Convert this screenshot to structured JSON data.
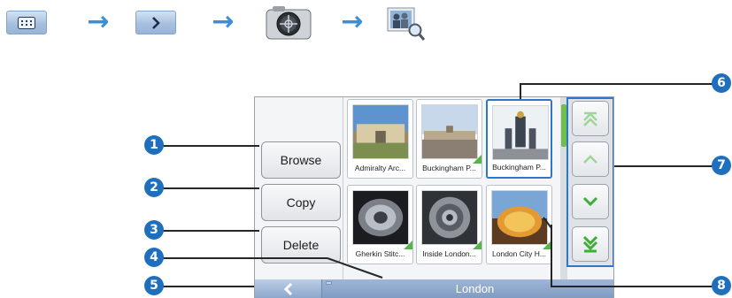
{
  "navigation_sequence": {
    "steps": [
      {
        "icon": "main-menu-grid-icon"
      },
      {
        "icon": "next-chevron-icon"
      },
      {
        "icon": "camera-icon"
      },
      {
        "icon": "photo-browse-icon"
      }
    ],
    "separator_icon": "right-arrow-icon"
  },
  "screen": {
    "side_buttons": [
      {
        "label": "Browse"
      },
      {
        "label": "Copy"
      },
      {
        "label": "Delete"
      }
    ],
    "thumbnails": [
      {
        "caption": "Admiralty Arc...",
        "selected": false
      },
      {
        "caption": "Buckingham P...",
        "selected": false
      },
      {
        "caption": "Buckingham P...",
        "selected": true
      },
      {
        "caption": "Gherkin Stitc...",
        "selected": false
      },
      {
        "caption": "Inside London...",
        "selected": false
      },
      {
        "caption": "London City H...",
        "selected": false
      }
    ],
    "scroll_buttons": [
      "scroll-top-icon",
      "scroll-up-icon",
      "scroll-down-icon",
      "scroll-bottom-icon"
    ],
    "bottom_bar": {
      "back_icon": "back-chevron-icon",
      "title": "London"
    }
  },
  "callouts": [
    "1",
    "2",
    "3",
    "4",
    "5",
    "6",
    "7",
    "8"
  ],
  "colors": {
    "accent": "#2e77c8",
    "badge": "#1f6fbf",
    "arrow": "#3a8fd8",
    "new_marker": "#57b44a"
  }
}
